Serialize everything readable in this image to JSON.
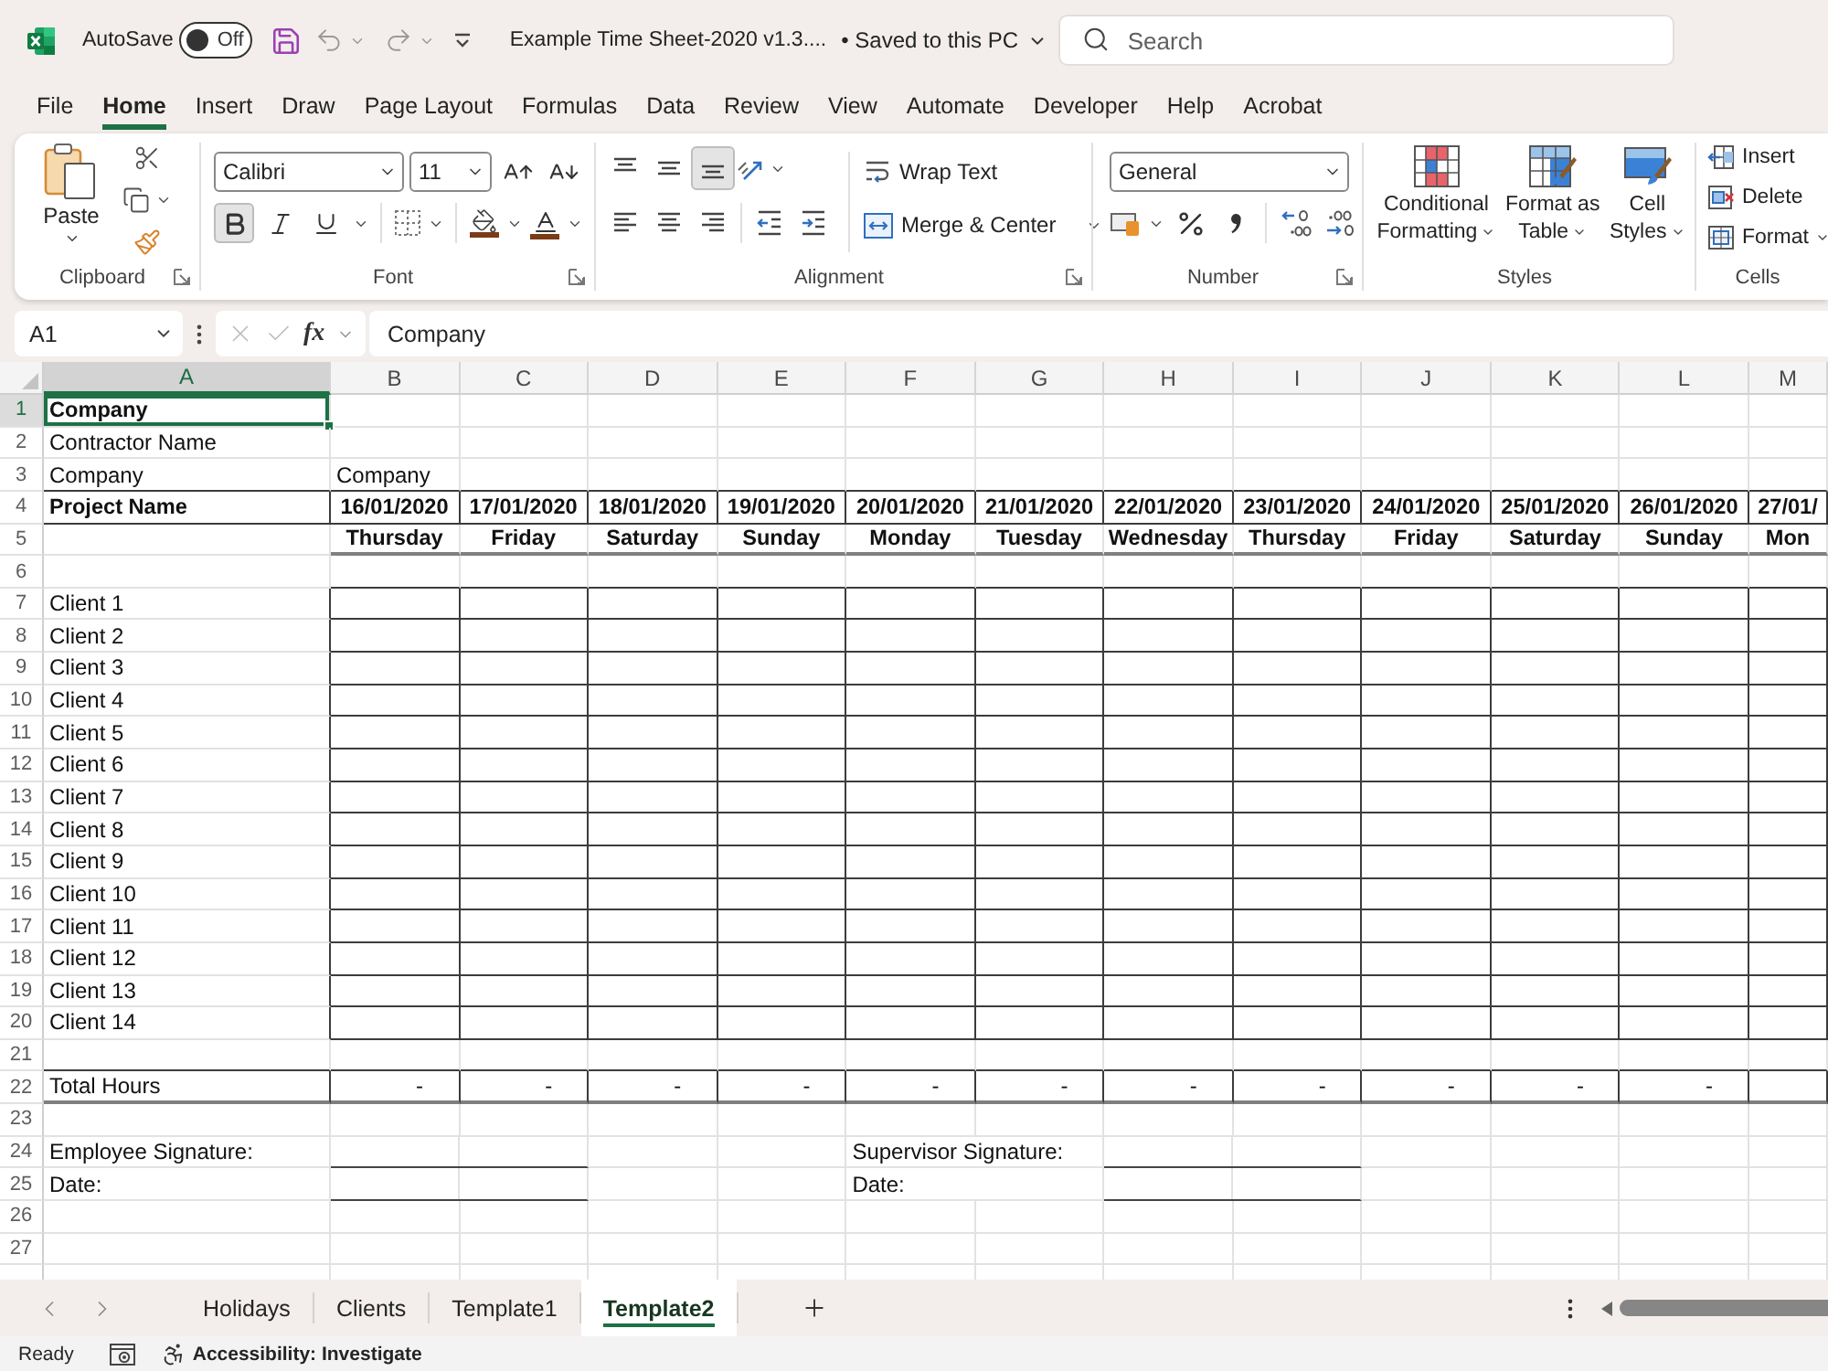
{
  "title_bar": {
    "autosave_label": "AutoSave",
    "autosave": {
      "on": false,
      "label": "Off"
    },
    "file_name": "Example Time Sheet-2020 v1.3....",
    "save_status": "• Saved to this PC",
    "search": {
      "placeholder": "Search"
    }
  },
  "menu_tabs": [
    {
      "label": "File",
      "selected": false
    },
    {
      "label": "Home",
      "selected": true
    },
    {
      "label": "Insert",
      "selected": false
    },
    {
      "label": "Draw",
      "selected": false
    },
    {
      "label": "Page Layout",
      "selected": false
    },
    {
      "label": "Formulas",
      "selected": false
    },
    {
      "label": "Data",
      "selected": false
    },
    {
      "label": "Review",
      "selected": false
    },
    {
      "label": "View",
      "selected": false
    },
    {
      "label": "Automate",
      "selected": false
    },
    {
      "label": "Developer",
      "selected": false
    },
    {
      "label": "Help",
      "selected": false
    },
    {
      "label": "Acrobat",
      "selected": false
    }
  ],
  "ribbon": {
    "clipboard": {
      "label": "Clipboard",
      "paste": "Paste"
    },
    "font": {
      "label": "Font",
      "font_name": "Calibri",
      "font_size": "11",
      "styles": [
        {
          "kind": "bold",
          "on": true
        },
        {
          "kind": "italic",
          "on": false
        },
        {
          "kind": "underline",
          "on": false
        }
      ]
    },
    "alignment": {
      "label": "Alignment",
      "vertical": [
        {
          "kind": "top",
          "selected": false
        },
        {
          "kind": "middle",
          "selected": false
        },
        {
          "kind": "bottom",
          "selected": true
        }
      ],
      "horizontal": [
        {
          "kind": "left",
          "selected": false
        },
        {
          "kind": "center",
          "selected": false
        },
        {
          "kind": "right",
          "selected": false
        }
      ],
      "wrap_text": "Wrap Text",
      "merge_center": "Merge & Center"
    },
    "number": {
      "label": "Number",
      "format": "General"
    },
    "styles": {
      "label": "Styles",
      "buttons": [
        {
          "kind": "conditional",
          "lines": [
            "Conditional",
            "Formatting"
          ]
        },
        {
          "kind": "table",
          "lines": [
            "Format as",
            "Table"
          ]
        },
        {
          "kind": "cell",
          "lines": [
            "Cell",
            "Styles"
          ]
        }
      ]
    },
    "cells": {
      "label": "Cells",
      "buttons": [
        {
          "kind": "insert",
          "label": "Insert"
        },
        {
          "kind": "delete",
          "label": "Delete"
        },
        {
          "kind": "format",
          "label": "Format"
        }
      ]
    }
  },
  "formula_bar": {
    "name_box": "A1",
    "insert_function": "fx",
    "formula": "Company"
  },
  "sheet": {
    "columns": [
      {
        "label": "A",
        "selected": true
      },
      {
        "label": "B",
        "selected": false
      },
      {
        "label": "C",
        "selected": false
      },
      {
        "label": "D",
        "selected": false
      },
      {
        "label": "E",
        "selected": false
      },
      {
        "label": "F",
        "selected": false
      },
      {
        "label": "G",
        "selected": false
      },
      {
        "label": "H",
        "selected": false
      },
      {
        "label": "I",
        "selected": false
      },
      {
        "label": "J",
        "selected": false
      },
      {
        "label": "K",
        "selected": false
      },
      {
        "label": "L",
        "selected": false
      },
      {
        "label": "M",
        "selected": false
      }
    ],
    "rows": [
      {
        "number": "1",
        "selected": true,
        "kind": "title",
        "cells": [
          {
            "kind": "text",
            "text": "Company",
            "selected": true
          }
        ]
      },
      {
        "number": "2",
        "selected": false,
        "kind": "plain",
        "cells": [
          {
            "kind": "text",
            "text": "Contractor Name",
            "selected": false
          }
        ]
      },
      {
        "number": "3",
        "selected": false,
        "kind": "plain",
        "cells": [
          {
            "kind": "text",
            "text": "Company",
            "selected": false
          },
          {
            "kind": "text",
            "text": "Company",
            "selected": false
          }
        ]
      },
      {
        "number": "4",
        "selected": false,
        "kind": "dates",
        "cells": [
          {
            "kind": "text",
            "text": "Project Name",
            "selected": false
          },
          {
            "kind": "text",
            "text": "16/01/2020",
            "selected": false
          },
          {
            "kind": "text",
            "text": "17/01/2020",
            "selected": false
          },
          {
            "kind": "text",
            "text": "18/01/2020",
            "selected": false
          },
          {
            "kind": "text",
            "text": "19/01/2020",
            "selected": false
          },
          {
            "kind": "text",
            "text": "20/01/2020",
            "selected": false
          },
          {
            "kind": "text",
            "text": "21/01/2020",
            "selected": false
          },
          {
            "kind": "text",
            "text": "22/01/2020",
            "selected": false
          },
          {
            "kind": "text",
            "text": "23/01/2020",
            "selected": false
          },
          {
            "kind": "text",
            "text": "24/01/2020",
            "selected": false
          },
          {
            "kind": "text",
            "text": "25/01/2020",
            "selected": false
          },
          {
            "kind": "text",
            "text": "26/01/2020",
            "selected": false
          },
          {
            "kind": "text",
            "text": "27/01/",
            "selected": false
          }
        ]
      },
      {
        "number": "5",
        "selected": false,
        "kind": "days",
        "cells": [
          null,
          {
            "kind": "text",
            "text": "Thursday",
            "selected": false
          },
          {
            "kind": "text",
            "text": "Friday",
            "selected": false
          },
          {
            "kind": "text",
            "text": "Saturday",
            "selected": false
          },
          {
            "kind": "text",
            "text": "Sunday",
            "selected": false
          },
          {
            "kind": "text",
            "text": "Monday",
            "selected": false
          },
          {
            "kind": "text",
            "text": "Tuesday",
            "selected": false
          },
          {
            "kind": "text",
            "text": "Wednesday",
            "selected": false
          },
          {
            "kind": "text",
            "text": "Thursday",
            "selected": false
          },
          {
            "kind": "text",
            "text": "Friday",
            "selected": false
          },
          {
            "kind": "text",
            "text": "Saturday",
            "selected": false
          },
          {
            "kind": "text",
            "text": "Sunday",
            "selected": false
          },
          {
            "kind": "text",
            "text": "Mon",
            "selected": false
          }
        ]
      },
      {
        "number": "6",
        "selected": false,
        "kind": "plain"
      },
      {
        "number": "7",
        "selected": false,
        "kind": "client",
        "cells": [
          {
            "kind": "text",
            "text": "Client 1",
            "selected": false
          }
        ]
      },
      {
        "number": "8",
        "selected": false,
        "kind": "client",
        "cells": [
          {
            "kind": "text",
            "text": "Client 2",
            "selected": false
          }
        ]
      },
      {
        "number": "9",
        "selected": false,
        "kind": "client",
        "cells": [
          {
            "kind": "text",
            "text": "Client 3",
            "selected": false
          }
        ]
      },
      {
        "number": "10",
        "selected": false,
        "kind": "client",
        "cells": [
          {
            "kind": "text",
            "text": "Client 4",
            "selected": false
          }
        ]
      },
      {
        "number": "11",
        "selected": false,
        "kind": "client",
        "cells": [
          {
            "kind": "text",
            "text": "Client 5",
            "selected": false
          }
        ]
      },
      {
        "number": "12",
        "selected": false,
        "kind": "client",
        "cells": [
          {
            "kind": "text",
            "text": "Client 6",
            "selected": false
          }
        ]
      },
      {
        "number": "13",
        "selected": false,
        "kind": "client",
        "cells": [
          {
            "kind": "text",
            "text": "Client 7",
            "selected": false
          }
        ]
      },
      {
        "number": "14",
        "selected": false,
        "kind": "client",
        "cells": [
          {
            "kind": "text",
            "text": "Client 8",
            "selected": false
          }
        ]
      },
      {
        "number": "15",
        "selected": false,
        "kind": "client",
        "cells": [
          {
            "kind": "text",
            "text": "Client 9",
            "selected": false
          }
        ]
      },
      {
        "number": "16",
        "selected": false,
        "kind": "client",
        "cells": [
          {
            "kind": "text",
            "text": "Client 10",
            "selected": false
          }
        ]
      },
      {
        "number": "17",
        "selected": false,
        "kind": "client",
        "cells": [
          {
            "kind": "text",
            "text": "Client 11",
            "selected": false
          }
        ]
      },
      {
        "number": "18",
        "selected": false,
        "kind": "client",
        "cells": [
          {
            "kind": "text",
            "text": "Client 12",
            "selected": false
          }
        ]
      },
      {
        "number": "19",
        "selected": false,
        "kind": "client",
        "cells": [
          {
            "kind": "text",
            "text": "Client 13",
            "selected": false
          }
        ]
      },
      {
        "number": "20",
        "selected": false,
        "kind": "client",
        "cells": [
          {
            "kind": "text",
            "text": "Client 14",
            "selected": false
          }
        ]
      },
      {
        "number": "21",
        "selected": false,
        "kind": "plain"
      },
      {
        "number": "22",
        "selected": false,
        "kind": "total",
        "cells": [
          {
            "kind": "text",
            "text": "Total Hours",
            "selected": false
          },
          {
            "kind": "text",
            "text": "-",
            "selected": false
          },
          {
            "kind": "text",
            "text": "-",
            "selected": false
          },
          {
            "kind": "text",
            "text": "-",
            "selected": false
          },
          {
            "kind": "text",
            "text": "-",
            "selected": false
          },
          {
            "kind": "text",
            "text": "-",
            "selected": false
          },
          {
            "kind": "text",
            "text": "-",
            "selected": false
          },
          {
            "kind": "text",
            "text": "-",
            "selected": false
          },
          {
            "kind": "text",
            "text": "-",
            "selected": false
          },
          {
            "kind": "text",
            "text": "-",
            "selected": false
          },
          {
            "kind": "text",
            "text": "-",
            "selected": false
          },
          {
            "kind": "text",
            "text": "-",
            "selected": false
          }
        ]
      },
      {
        "number": "23",
        "selected": false,
        "kind": "plain"
      },
      {
        "number": "24",
        "selected": false,
        "kind": "signature",
        "cells": [
          {
            "kind": "text",
            "text": "Employee Signature:",
            "selected": false
          },
          {
            "kind": "line"
          },
          {
            "kind": "line"
          },
          null,
          null,
          {
            "kind": "text",
            "text": "Supervisor Signature:",
            "selected": false
          },
          null,
          {
            "kind": "line"
          },
          {
            "kind": "line"
          }
        ]
      },
      {
        "number": "25",
        "selected": false,
        "kind": "signature",
        "cells": [
          {
            "kind": "text",
            "text": "Date:",
            "selected": false
          },
          {
            "kind": "line"
          },
          {
            "kind": "line"
          },
          null,
          null,
          {
            "kind": "text",
            "text": "Date:",
            "selected": false
          },
          null,
          {
            "kind": "line"
          },
          {
            "kind": "line"
          }
        ]
      },
      {
        "number": "26",
        "selected": false,
        "kind": "plain"
      },
      {
        "number": "27",
        "selected": false,
        "kind": "plain"
      }
    ]
  },
  "sheet_tabs": [
    {
      "label": "Holidays",
      "selected": false
    },
    {
      "label": "Clients",
      "selected": false
    },
    {
      "label": "Template1",
      "selected": false
    },
    {
      "label": "Template2",
      "selected": true
    }
  ],
  "status_bar": {
    "ready": "Ready",
    "accessibility": "Accessibility: Investigate"
  }
}
